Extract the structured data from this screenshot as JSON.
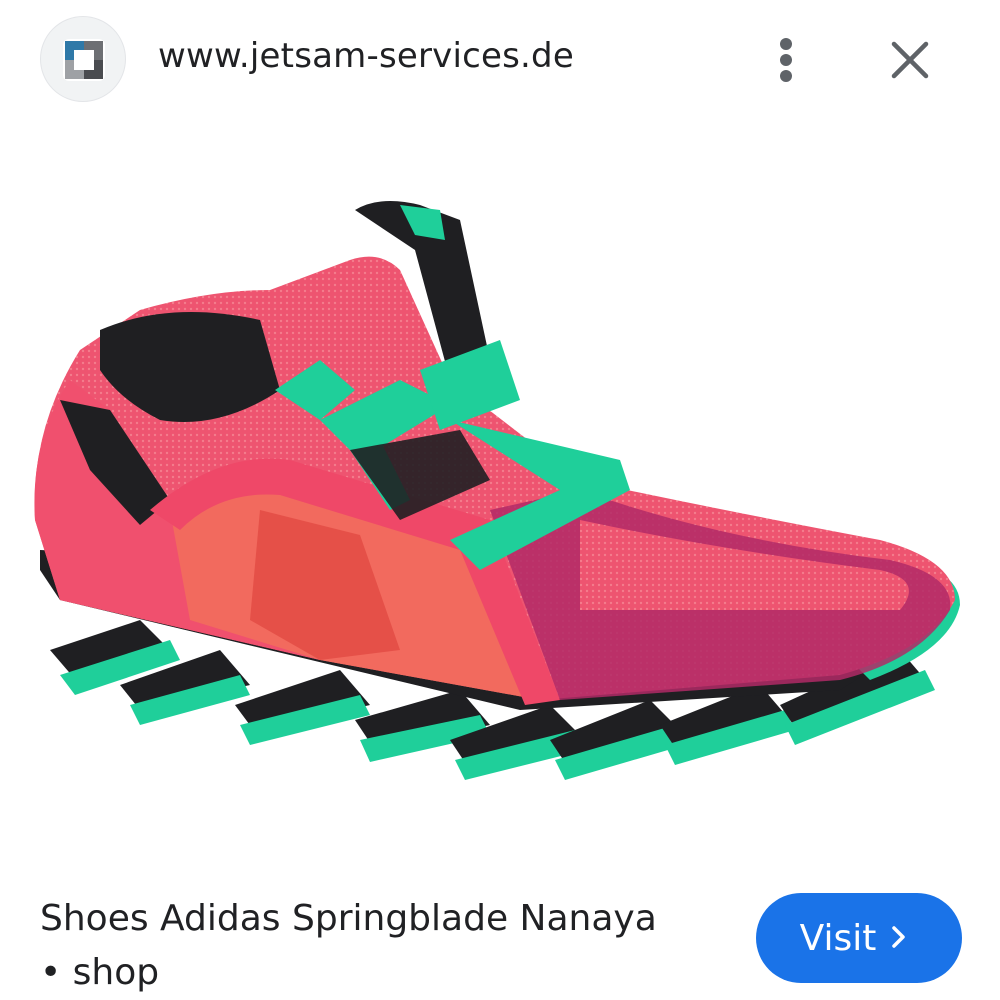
{
  "header": {
    "url": "www.jetsam-services.de",
    "site_icon": "jetsam-logo-icon",
    "menu_icon": "more-vert-icon",
    "close_icon": "close-icon"
  },
  "image": {
    "subject": "pink and teal running shoe"
  },
  "footer": {
    "title_line1": "Shoes Adidas Springblade Nanaya",
    "title_line2": "• shop",
    "visit_label": "Visit",
    "visit_icon": "chevron-right-icon"
  },
  "colors": {
    "accent": "#1a73e8",
    "shoe_pink": "#ec4e6e",
    "shoe_magenta": "#b22a66",
    "shoe_teal": "#1fcf9a",
    "shoe_black": "#1f1f22"
  }
}
